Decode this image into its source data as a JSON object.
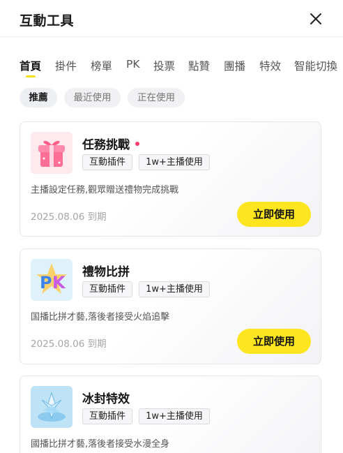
{
  "header": {
    "title": "互動工具"
  },
  "tabs": [
    {
      "label": "首頁"
    },
    {
      "label": "掛件"
    },
    {
      "label": "榜單"
    },
    {
      "label": "PK"
    },
    {
      "label": "投票"
    },
    {
      "label": "點贊"
    },
    {
      "label": "團播"
    },
    {
      "label": "特效"
    },
    {
      "label": "智能切換"
    }
  ],
  "active_tab": "首頁",
  "filters": [
    {
      "label": "推薦"
    },
    {
      "label": "最近使用"
    },
    {
      "label": "正在使用"
    }
  ],
  "active_filter": "推薦",
  "cards": [
    {
      "icon": "gift-box-icon",
      "title": "任務挑戰",
      "has_new_dot": true,
      "tags": [
        "互動插件",
        "1w+主播使用"
      ],
      "description": "主播設定任務,觀眾贈送禮物完成挑戰",
      "expiry": "2025.08.06 到期",
      "button": "立即使用"
    },
    {
      "icon": "pk-icon",
      "title": "禮物比拼",
      "has_new_dot": false,
      "tags": [
        "互動插件",
        "1w+主播使用"
      ],
      "description": "国播比拼才藝,落後者接受火焰追擊",
      "expiry": "2025.08.06 到期",
      "button": "立即使用"
    },
    {
      "icon": "ice-crystal-icon",
      "title": "冰封特效",
      "has_new_dot": false,
      "tags": [
        "互動插件",
        "1w+主播使用"
      ],
      "description": "國播比拼才藝,落後者接受水漫全身",
      "expiry": "",
      "button": ""
    }
  ],
  "colors": {
    "accent": "#fde51f",
    "dot": "#ff3b6f",
    "tab_indicator": "#f5e01c"
  }
}
